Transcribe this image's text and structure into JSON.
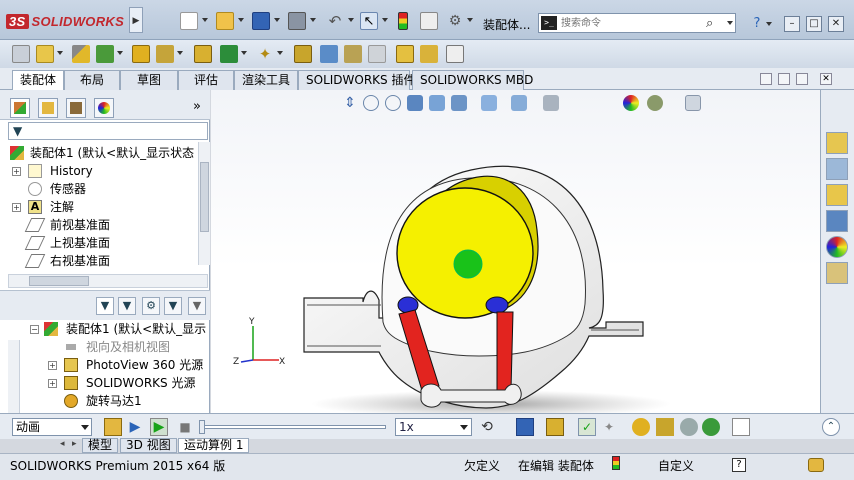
{
  "app": {
    "logo_text": "SOLIDWORKS",
    "logo_mark": "3S",
    "document_title": "装配体...",
    "search": {
      "placeholder": "搜索命令",
      "cmd_icon": ">_"
    }
  },
  "command_tabs": [
    "装配体",
    "布局",
    "草图",
    "评估",
    "渲染工具",
    "SOLIDWORKS 插件",
    "SOLIDWORKS MBD"
  ],
  "feature_manager": {
    "more_label": "»",
    "filter_label": "▼",
    "root": {
      "label": "装配体1 (默认<默认_显示状态"
    },
    "items": [
      {
        "label": "History",
        "expander": "+",
        "icon": "history-icon"
      },
      {
        "label": "传感器",
        "expander": "",
        "icon": "sensor-icon"
      },
      {
        "label": "注解",
        "expander": "+",
        "icon": "annotation-icon",
        "icon_text": "A"
      },
      {
        "label": "前视基准面",
        "expander": "",
        "icon": "plane-icon"
      },
      {
        "label": "上视基准面",
        "expander": "",
        "icon": "plane-icon"
      },
      {
        "label": "右视基准面",
        "expander": "",
        "icon": "plane-icon"
      }
    ],
    "motion_tree": {
      "root": "装配体1 (默认<默认_显示",
      "items": [
        {
          "label": "视向及相机视图",
          "expander": "",
          "dim": true
        },
        {
          "label": "PhotoView 360 光源",
          "expander": "+",
          "dim": false
        },
        {
          "label": "SOLIDWORKS 光源",
          "expander": "+",
          "dim": false
        },
        {
          "label": "旋转马达1",
          "expander": "",
          "dim": false
        }
      ]
    }
  },
  "motion_manager": {
    "study_type": "动画",
    "speed": "1x"
  },
  "bottom_tabs": [
    "模型",
    "3D 视图",
    "运动算例 1"
  ],
  "active_bottom_tab": 2,
  "status_bar": {
    "product": "SOLIDWORKS Premium 2015 x64 版",
    "definition": "欠定义",
    "editing": "在编辑 装配体",
    "units": "自定义",
    "help": "?"
  },
  "triad": {
    "x": "X",
    "y": "Y",
    "z": "Z"
  },
  "colors": {
    "titlebar": "#bfcde0",
    "viewport_bg": "#ffffff",
    "wheel": "#f5f000",
    "hub": "#19c219",
    "links": "#e2241f",
    "pins": "#2a2fd6",
    "housing": "#f4f4f4"
  }
}
